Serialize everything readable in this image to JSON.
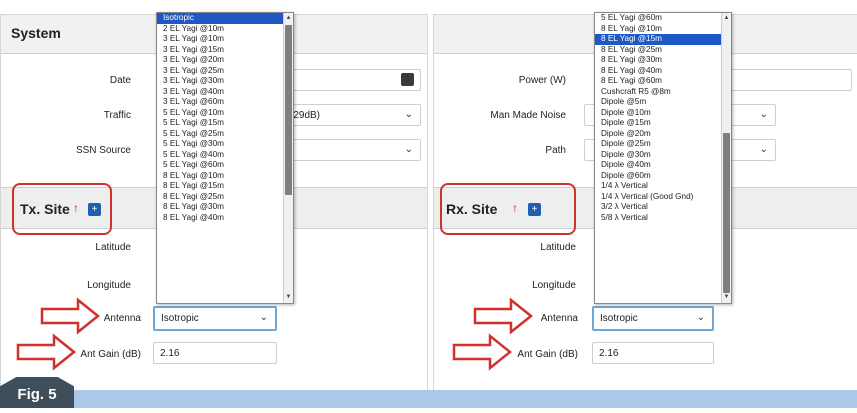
{
  "colors": {
    "accent_blue": "#1f5fae",
    "highlight_red": "#d0312d",
    "selection_blue": "#1e58c6",
    "footer_bar": "#a9c9e6",
    "fig_tab": "#3e4e5a"
  },
  "left_panel": {
    "title": "System",
    "fields": {
      "date_label": "Date",
      "traffic_label": "Traffic",
      "traffic_value": "-29dB)",
      "ssn_label": "SSN Source"
    },
    "tx_site": {
      "title": "Tx. Site",
      "pin_icon": "↑",
      "add_label": "+",
      "latitude_label": "Latitude",
      "longitude_label": "Longitude",
      "antenna_label": "Antenna",
      "antenna_value": "Isotropic",
      "ant_gain_label": "Ant Gain (dB)",
      "ant_gain_value": "2.16"
    },
    "dropdown_items": [
      "Isotropic",
      "2 EL Yagi @10m",
      "3 EL Yagi @10m",
      "3 EL Yagi @15m",
      "3 EL Yagi @20m",
      "3 EL Yagi @25m",
      "3 EL Yagi @30m",
      "3 EL Yagi @40m",
      "3 EL Yagi @60m",
      "5 EL Yagi @10m",
      "5 EL Yagi @15m",
      "5 EL Yagi @25m",
      "5 EL Yagi @30m",
      "5 EL Yagi @40m",
      "5 EL Yagi @60m",
      "8 EL Yagi @10m",
      "8 EL Yagi @15m",
      "8 EL Yagi @25m",
      "8 EL Yagi @30m",
      "8 EL Yagi @40m"
    ]
  },
  "right_panel": {
    "fields": {
      "power_label": "Power (W)",
      "noise_label": "Man Made Noise",
      "path_label": "Path"
    },
    "rx_site": {
      "title": "Rx. Site",
      "pin_icon": "↑",
      "add_label": "+",
      "latitude_label": "Latitude",
      "longitude_label": "Longitude",
      "antenna_label": "Antenna",
      "antenna_value": "Isotropic",
      "ant_gain_label": "Ant Gain (dB)",
      "ant_gain_value": "2.16"
    },
    "dropdown_items": [
      "5 EL Yagi @60m",
      "8 EL Yagi @10m",
      "8 EL Yagi @15m",
      "8 EL Yagi @25m",
      "8 EL Yagi @30m",
      "8 EL Yagi @40m",
      "8 EL Yagi @60m",
      "Cushcraft R5 @8m",
      "Dipole @5m",
      "Dipole @10m",
      "Dipole @15m",
      "Dipole @20m",
      "Dipole @25m",
      "Dipole @30m",
      "Dipole @40m",
      "Dipole @60m",
      "1/4 λ Vertical",
      "1/4 λ Vertical (Good Gnd)",
      "3/2 λ Vertical",
      "5/8 λ Vertical"
    ],
    "dropdown_selected_index": 2
  },
  "figure_label": "Fig. 5"
}
